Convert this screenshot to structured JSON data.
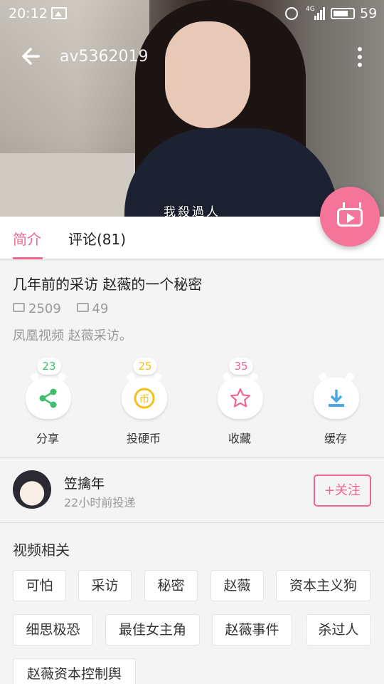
{
  "status_bar": {
    "time": "20:12",
    "network": "4G",
    "battery": "59"
  },
  "app_bar": {
    "title": "av5362019"
  },
  "video": {
    "subtitle": "我殺過人"
  },
  "tabs": [
    {
      "label": "简介"
    },
    {
      "label": "评论(81)"
    }
  ],
  "intro": {
    "title": "几年前的采访 赵薇的一个秘密",
    "plays": "2509",
    "danmaku": "49",
    "description": "凤凰视频 赵薇采访。"
  },
  "actions": [
    {
      "label": "分享",
      "count": "23",
      "color": "#3fbf6e",
      "icon": "share-icon"
    },
    {
      "label": "投硬币",
      "count": "25",
      "color": "#f2c21c",
      "icon": "coin-icon"
    },
    {
      "label": "收藏",
      "count": "35",
      "color": "#f0668f",
      "icon": "star-icon"
    },
    {
      "label": "缓存",
      "count": "",
      "color": "#4ba7e6",
      "icon": "download-icon"
    }
  ],
  "uploader": {
    "name": "笠擒年",
    "time": "22小时前投递",
    "follow_label": "+关注"
  },
  "related": {
    "title": "视频相关",
    "tags": [
      "可怕",
      "采访",
      "秘密",
      "赵薇",
      "资本主义狗",
      "细思极恐",
      "最佳女主角",
      "赵薇事件",
      "杀过人",
      "赵薇资本控制舆论"
    ]
  }
}
